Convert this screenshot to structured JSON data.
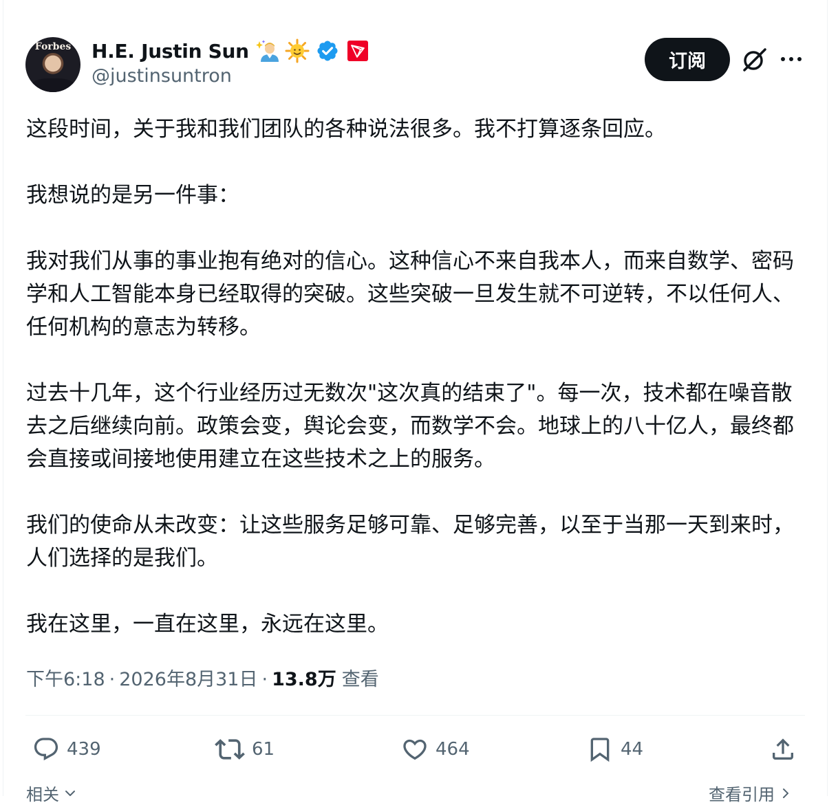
{
  "author": {
    "name": "H.E. Justin Sun",
    "handle": "@justinsuntron",
    "avatar_text": "Forbes",
    "badges": [
      "sparkle-person-emoji",
      "sun-emoji",
      "verified-badge-icon",
      "tron-logo-icon"
    ],
    "verified_color": "#1d9bf0",
    "tron_color": "#ef0027"
  },
  "header": {
    "subscribe_label": "订阅",
    "grok_icon": "grok-icon",
    "more_icon": "more-icon"
  },
  "tweet": {
    "paragraphs": [
      "这段时间，关于我和我们团队的各种说法很多。我不打算逐条回应。",
      "我想说的是另一件事：",
      "我对我们从事的事业抱有绝对的信心。这种信心不来自我本人，而来自数学、密码学和人工智能本身已经取得的突破。这些突破一旦发生就不可逆转，不以任何人、任何机构的意志为转移。",
      "过去十几年，这个行业经历过无数次\"这次真的结束了\"。每一次，技术都在噪音散去之后继续向前。政策会变，舆论会变，而数学不会。地球上的八十亿人，最终都会直接或间接地使用建立在这些技术之上的服务。",
      "我们的使命从未改变：让这些服务足够可靠、足够完善，以至于当那一天到来时，人们选择的是我们。",
      "我在这里，一直在这里，永远在这里。"
    ],
    "time": "下午6:18",
    "date": "2026年8月31日",
    "separator": "·",
    "views_count": "13.8万",
    "views_label": "查看"
  },
  "actions": {
    "replies": "439",
    "reposts": "61",
    "likes": "464",
    "bookmarks": "44"
  },
  "footer": {
    "related_label": "相关",
    "quotes_label": "查看引用"
  }
}
